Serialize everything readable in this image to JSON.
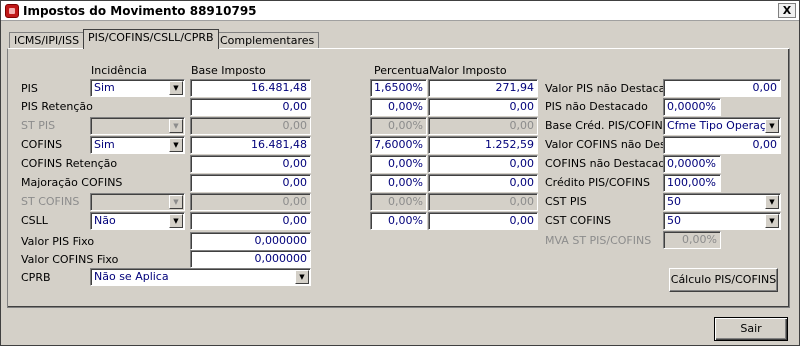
{
  "window": {
    "title": "Impostos do Movimento 88910795",
    "close_label": "X"
  },
  "tabs": [
    {
      "label": "ICMS/IPI/ISS",
      "active": false
    },
    {
      "label": "PIS/COFINS/CSLL/CPRB",
      "active": true
    },
    {
      "label": "Complementares",
      "active": false
    }
  ],
  "headers": {
    "incidencia": "Incidência",
    "base_imposto": "Base Imposto",
    "percentual": "Percentual",
    "valor_imposto": "Valor Imposto"
  },
  "rows": [
    {
      "label": "PIS",
      "incidencia": "Sim",
      "base": "16.481,48",
      "percentual": "1,6500%",
      "valor": "271,94",
      "disabled": false
    },
    {
      "label": "PIS Retenção",
      "incidencia": null,
      "base": "0,00",
      "percentual": "0,00%",
      "valor": "0,00",
      "disabled": false
    },
    {
      "label": "ST PIS",
      "incidencia": "",
      "base": "0,00",
      "percentual": "0,00%",
      "valor": "0,00",
      "disabled": true
    },
    {
      "label": "COFINS",
      "incidencia": "Sim",
      "base": "16.481,48",
      "percentual": "7,6000%",
      "valor": "1.252,59",
      "disabled": false
    },
    {
      "label": "COFINS Retenção",
      "incidencia": null,
      "base": "0,00",
      "percentual": "0,00%",
      "valor": "0,00",
      "disabled": false
    },
    {
      "label": "Majoração COFINS",
      "incidencia": null,
      "base": "0,00",
      "percentual": "0,00%",
      "valor": "0,00",
      "disabled": false
    },
    {
      "label": "ST COFINS",
      "incidencia": "",
      "base": "0,00",
      "percentual": "0,00%",
      "valor": "0,00",
      "disabled": true
    },
    {
      "label": "CSLL",
      "incidencia": "Não",
      "base": "0,00",
      "percentual": "0,00%",
      "valor": "0,00",
      "disabled": false
    }
  ],
  "fixos": {
    "valor_pis_fixo_label": "Valor PIS Fixo",
    "valor_pis_fixo": "0,000000",
    "valor_cofins_fixo_label": "Valor COFINS Fixo",
    "valor_cofins_fixo": "0,000000"
  },
  "cprb": {
    "label": "CPRB",
    "value": "Não se Aplica"
  },
  "right": {
    "valor_pis_nao_destacado_label": "Valor PIS não Destacado",
    "valor_pis_nao_destacado": "0,00",
    "pis_nao_destacado_label": "PIS não Destacado",
    "pis_nao_destacado": "0,0000%",
    "base_cred_label": "Base Créd. PIS/COFINS",
    "base_cred_value": "Cfme Tipo Operação",
    "valor_cofins_nao_dest_label": "Valor COFINS não Dest.",
    "valor_cofins_nao_dest": "0,00",
    "cofins_nao_destacado_label": "COFINS não Destacado",
    "cofins_nao_destacado": "0,0000%",
    "credito_label": "Crédito PIS/COFINS",
    "credito": "100,00%",
    "cst_pis_label": "CST PIS",
    "cst_pis": "50",
    "cst_cofins_label": "CST COFINS",
    "cst_cofins": "50",
    "mva_label": "MVA ST PIS/COFINS",
    "mva": "0,00%"
  },
  "buttons": {
    "calculo": "Cálculo PIS/COFINS",
    "sair": "Sair"
  },
  "icons": {
    "app": "app-logo-icon",
    "dropdown": "▼"
  }
}
